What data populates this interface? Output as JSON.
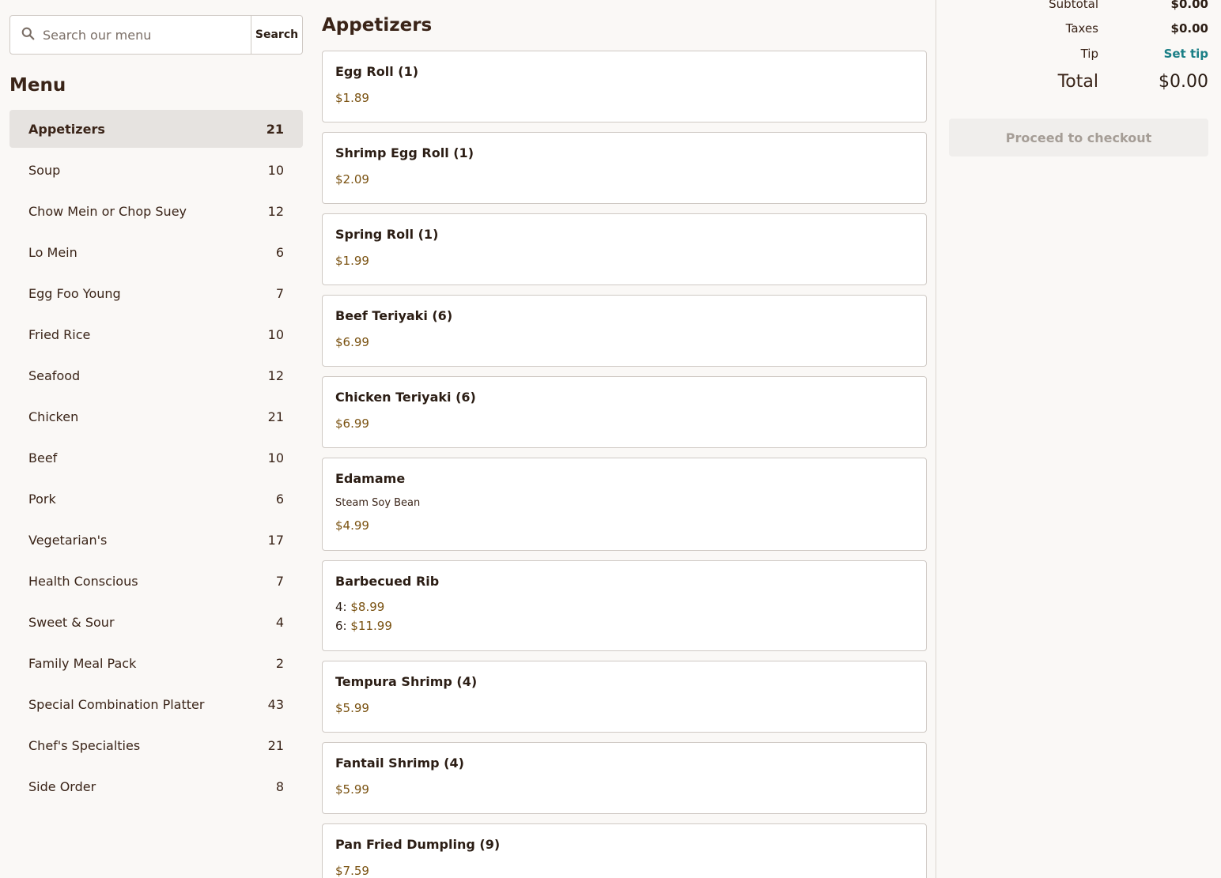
{
  "search": {
    "placeholder": "Search our menu",
    "button_label": "Search"
  },
  "menu": {
    "heading": "Menu",
    "categories": [
      {
        "label": "Appetizers",
        "count": "21",
        "active": true
      },
      {
        "label": "Soup",
        "count": "10"
      },
      {
        "label": "Chow Mein or Chop Suey",
        "count": "12"
      },
      {
        "label": "Lo Mein",
        "count": "6"
      },
      {
        "label": "Egg Foo Young",
        "count": "7"
      },
      {
        "label": "Fried Rice",
        "count": "10"
      },
      {
        "label": "Seafood",
        "count": "12"
      },
      {
        "label": "Chicken",
        "count": "21"
      },
      {
        "label": "Beef",
        "count": "10"
      },
      {
        "label": "Pork",
        "count": "6"
      },
      {
        "label": "Vegetarian's",
        "count": "17"
      },
      {
        "label": "Health Conscious",
        "count": "7"
      },
      {
        "label": "Sweet & Sour",
        "count": "4"
      },
      {
        "label": "Family Meal Pack",
        "count": "2"
      },
      {
        "label": "Special Combination Platter",
        "count": "43"
      },
      {
        "label": "Chef's Specialties",
        "count": "21"
      },
      {
        "label": "Side Order",
        "count": "8"
      }
    ]
  },
  "section": {
    "title": "Appetizers",
    "items": [
      {
        "name": "Egg Roll (1)",
        "price": "$1.89"
      },
      {
        "name": "Shrimp Egg Roll (1)",
        "price": "$2.09"
      },
      {
        "name": "Spring Roll (1)",
        "price": "$1.99"
      },
      {
        "name": "Beef Teriyaki (6)",
        "price": "$6.99"
      },
      {
        "name": "Chicken Teriyaki (6)",
        "price": "$6.99"
      },
      {
        "name": "Edamame",
        "description": "Steam Soy Bean",
        "price": "$4.99"
      },
      {
        "name": "Barbecued Rib",
        "options": [
          {
            "label": "4:",
            "price": "$8.99"
          },
          {
            "label": "6:",
            "price": "$11.99"
          }
        ]
      },
      {
        "name": "Tempura Shrimp (4)",
        "price": "$5.99"
      },
      {
        "name": "Fantail Shrimp (4)",
        "price": "$5.99"
      },
      {
        "name": "Pan Fried Dumpling (9)",
        "price": "$7.59"
      }
    ]
  },
  "summary": {
    "subtotal_label": "Subtotal",
    "subtotal_value": "$0.00",
    "taxes_label": "Taxes",
    "taxes_value": "$0.00",
    "tip_label": "Tip",
    "tip_value": "Set tip",
    "total_label": "Total",
    "total_value": "$0.00",
    "checkout_label": "Proceed to checkout"
  },
  "colors": {
    "accent_link": "#1a7f86",
    "price": "#7a5211",
    "active_category_bg": "#e6e3e0"
  }
}
